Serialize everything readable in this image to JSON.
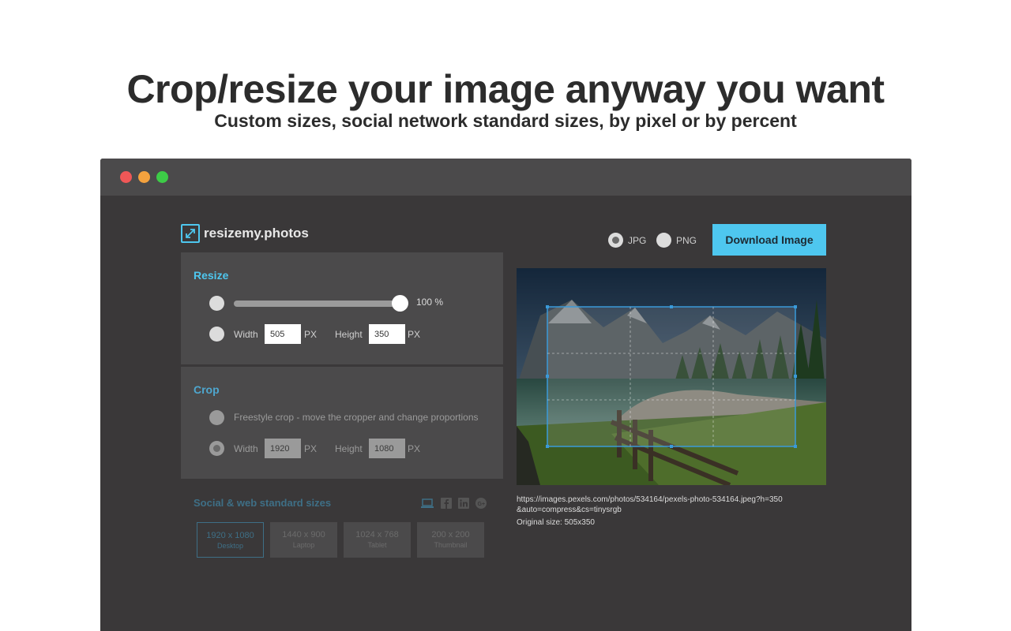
{
  "hero": {
    "title": "Crop/resize your image anyway you want",
    "subtitle": "Custom sizes, social network standard sizes, by pixel or by percent"
  },
  "app": {
    "logo_text": "resizemy.photos"
  },
  "resize": {
    "title": "Resize",
    "slider_value": "100 %",
    "slider_fraction": 1.0,
    "width_label": "Width",
    "width_value": "505",
    "height_label": "Height",
    "height_value": "350",
    "unit": "PX"
  },
  "crop": {
    "title": "Crop",
    "freestyle_label": "Freestyle crop - move the cropper and change proportions",
    "width_label": "Width",
    "width_value": "1920",
    "height_label": "Height",
    "height_value": "1080",
    "unit": "PX"
  },
  "social": {
    "title": "Social & web standard sizes",
    "icons": [
      "laptop-icon",
      "facebook-icon",
      "linkedin-icon",
      "google-plus-icon"
    ],
    "sizes": [
      {
        "main": "1920 x 1080",
        "sub": "Desktop"
      },
      {
        "main": "1440 x 900",
        "sub": "Laptop"
      },
      {
        "main": "1024 x 768",
        "sub": "Tablet"
      },
      {
        "main": "200 x 200",
        "sub": "Thumbnail"
      }
    ]
  },
  "output": {
    "format_jpg": "JPG",
    "format_png": "PNG",
    "selected_format": "JPG",
    "download_label": "Download Image"
  },
  "image": {
    "url": "https://images.pexels.com/photos/534164/pexels-photo-534164.jpeg?h=350&auto=compress&cs=tinysrgb",
    "original_size": "Original size: 505x350"
  },
  "colors": {
    "accent": "#4ec7ef",
    "window_bg": "#3a3839",
    "panel_bg": "#4b4a4b",
    "titlebar_bg": "#4b4a4b"
  }
}
